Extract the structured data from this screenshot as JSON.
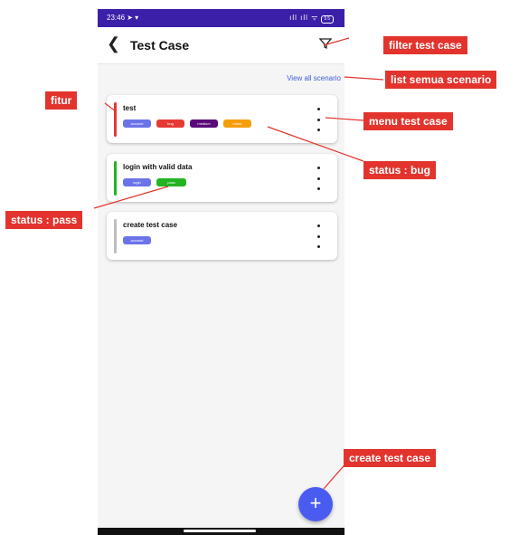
{
  "statusbar": {
    "time": "23:46",
    "signal": "ıll ıll ᯤ",
    "battery": "55"
  },
  "appbar": {
    "title": "Test Case"
  },
  "view_all": "View all scenario",
  "cards": [
    {
      "title": "test",
      "status_color": "#e53935",
      "tags": [
        {
          "label": "account",
          "color": "#6b73e8"
        },
        {
          "label": "bug",
          "color": "#e53935"
        },
        {
          "label": "medium",
          "color": "#5a0a7a"
        },
        {
          "label": "minor",
          "color": "#f59e0b"
        }
      ]
    },
    {
      "title": "login with valid data",
      "status_color": "#22b422",
      "tags": [
        {
          "label": "login",
          "color": "#6b73e8"
        },
        {
          "label": "pass",
          "color": "#22b422"
        }
      ]
    },
    {
      "title": "create test case",
      "status_color": "#bdbdbd",
      "tags": [
        {
          "label": "account",
          "color": "#6b73e8"
        }
      ]
    }
  ],
  "fab_label": "+",
  "callouts": {
    "filter": "filter test case",
    "list": "list semua scenario",
    "fitur": "fitur",
    "menu": "menu test case",
    "bug": "status : bug",
    "pass": "status : pass",
    "create": "create test case"
  },
  "colors": {
    "statusbar": "#3b1fa8",
    "accent": "#4a5cf0",
    "callout": "#e2342d"
  }
}
